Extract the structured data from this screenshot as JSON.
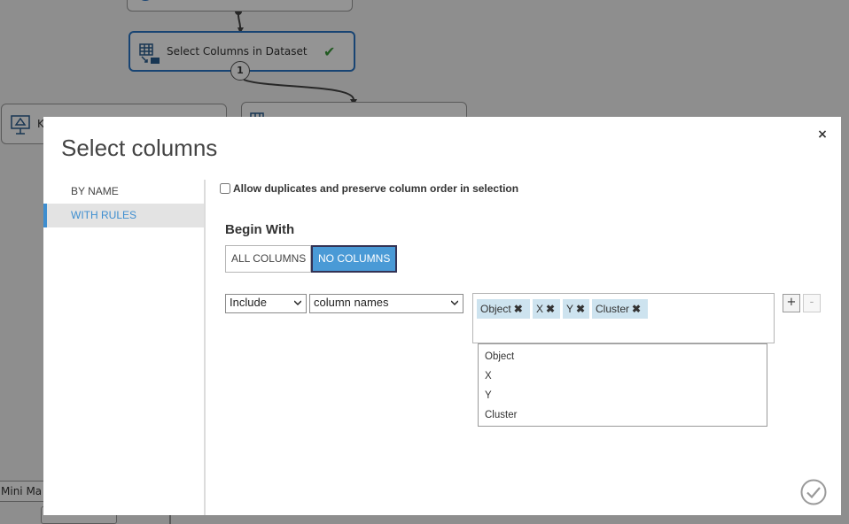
{
  "canvas": {
    "selected_node_label": "Select Columns in Dataset",
    "port_number": "1",
    "left_node_label": "K",
    "mini_node_label": "Mini Ma"
  },
  "dialog": {
    "title": "Select columns",
    "nav": [
      {
        "label": "BY NAME",
        "active": false
      },
      {
        "label": "WITH RULES",
        "active": true
      }
    ],
    "allow_duplicates_label": "Allow duplicates and preserve column order in selection",
    "allow_duplicates_checked": false,
    "begin_with_label": "Begin With",
    "begin_with_options": [
      "ALL COLUMNS",
      "NO COLUMNS"
    ],
    "begin_with_selected": "NO COLUMNS",
    "rule": {
      "mode": "Include",
      "type": "column names",
      "tags": [
        "Object",
        "X",
        "Y",
        "Cluster"
      ]
    },
    "dropdown_items": [
      "Object",
      "X",
      "Y",
      "Cluster"
    ],
    "add_label": "+",
    "remove_label": "-",
    "close_glyph": "×",
    "tag_remove_glyph": "✖"
  },
  "colors": {
    "accent": "#3e8ed0",
    "selected_button": "#4a9ad6",
    "tag_bg": "#cde3ef",
    "success": "#3a9b3a"
  }
}
